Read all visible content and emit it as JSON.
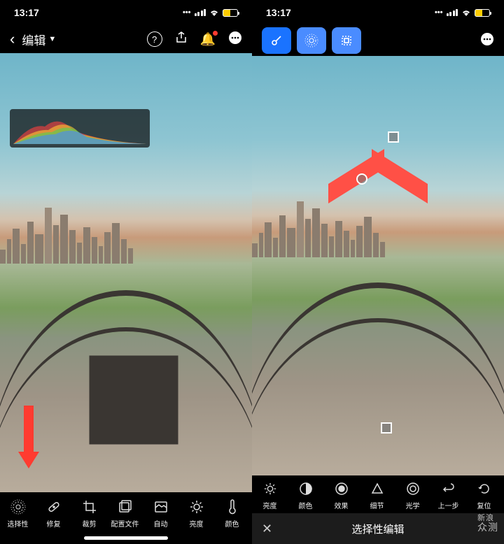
{
  "status": {
    "time": "13:17"
  },
  "left": {
    "title": "编辑",
    "toolbar": [
      {
        "id": "selective",
        "label": "选择性",
        "glyph": "◉"
      },
      {
        "id": "heal",
        "label": "修复",
        "glyph": "🩹"
      },
      {
        "id": "crop",
        "label": "裁剪",
        "glyph": "✂"
      },
      {
        "id": "profile",
        "label": "配置文件",
        "glyph": "🖼"
      },
      {
        "id": "auto",
        "label": "自动",
        "glyph": "▥"
      },
      {
        "id": "light",
        "label": "亮度",
        "glyph": "☀"
      },
      {
        "id": "color",
        "label": "颜色",
        "glyph": "🌡"
      }
    ]
  },
  "right": {
    "subtitle": "选择性编辑",
    "toolbar": [
      {
        "id": "light",
        "label": "亮度",
        "glyph": "☀"
      },
      {
        "id": "color",
        "label": "颜色",
        "glyph": "◑"
      },
      {
        "id": "effect",
        "label": "效果",
        "glyph": "◐"
      },
      {
        "id": "detail",
        "label": "细节",
        "glyph": "△"
      },
      {
        "id": "optics",
        "label": "光学",
        "glyph": "◎"
      },
      {
        "id": "undo",
        "label": "上一步",
        "glyph": "↶"
      },
      {
        "id": "reset",
        "label": "复位",
        "glyph": "⟲"
      }
    ]
  },
  "watermark": {
    "line1": "新浪",
    "line2": "众测"
  }
}
